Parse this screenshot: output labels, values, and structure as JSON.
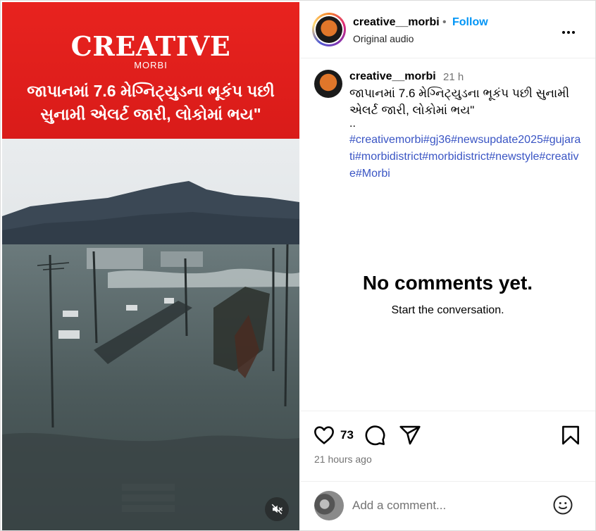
{
  "post": {
    "username": "creative__morbi",
    "follow_label": "Follow",
    "separator": "•",
    "audio": "Original audio",
    "caption_time": "21 h",
    "caption_text": "જાપાનમાં 7.6 મેગ્નિટ્યુડના ભૂકંપ પછી સુનામી એલર્ટ જારી, લોકોમાં ભય\"",
    "caption_more": "..",
    "hashtags": "#creativemorbi#gj36#newsupdate2025#gujarati#morbidistrict#morbidistrict#newstyle#creative#Morbi"
  },
  "media": {
    "brand": "CREATIVE",
    "brand_sub": "MORBI",
    "headline": "જાપાનમાં 7.6 મેગ્નિટ્યુડના ભૂકંપ પછી સુનામી એલર્ટ જારી, લોકોમાં ભય\"",
    "mute_icon": "speaker-muted-icon"
  },
  "comments": {
    "empty_title": "No comments yet.",
    "empty_subtitle": "Start the conversation."
  },
  "actions": {
    "like_count": "73",
    "posted_ago": "21 hours ago",
    "icons": [
      "heart-icon",
      "comment-icon",
      "share-icon",
      "bookmark-icon"
    ]
  },
  "comment_bar": {
    "placeholder": "Add a comment...",
    "emoji_icon": "smiley-icon"
  },
  "colors": {
    "follow": "#0095f6",
    "hashtag": "#3a55c4",
    "banner": "#e0211d",
    "muted_text": "#737373"
  }
}
